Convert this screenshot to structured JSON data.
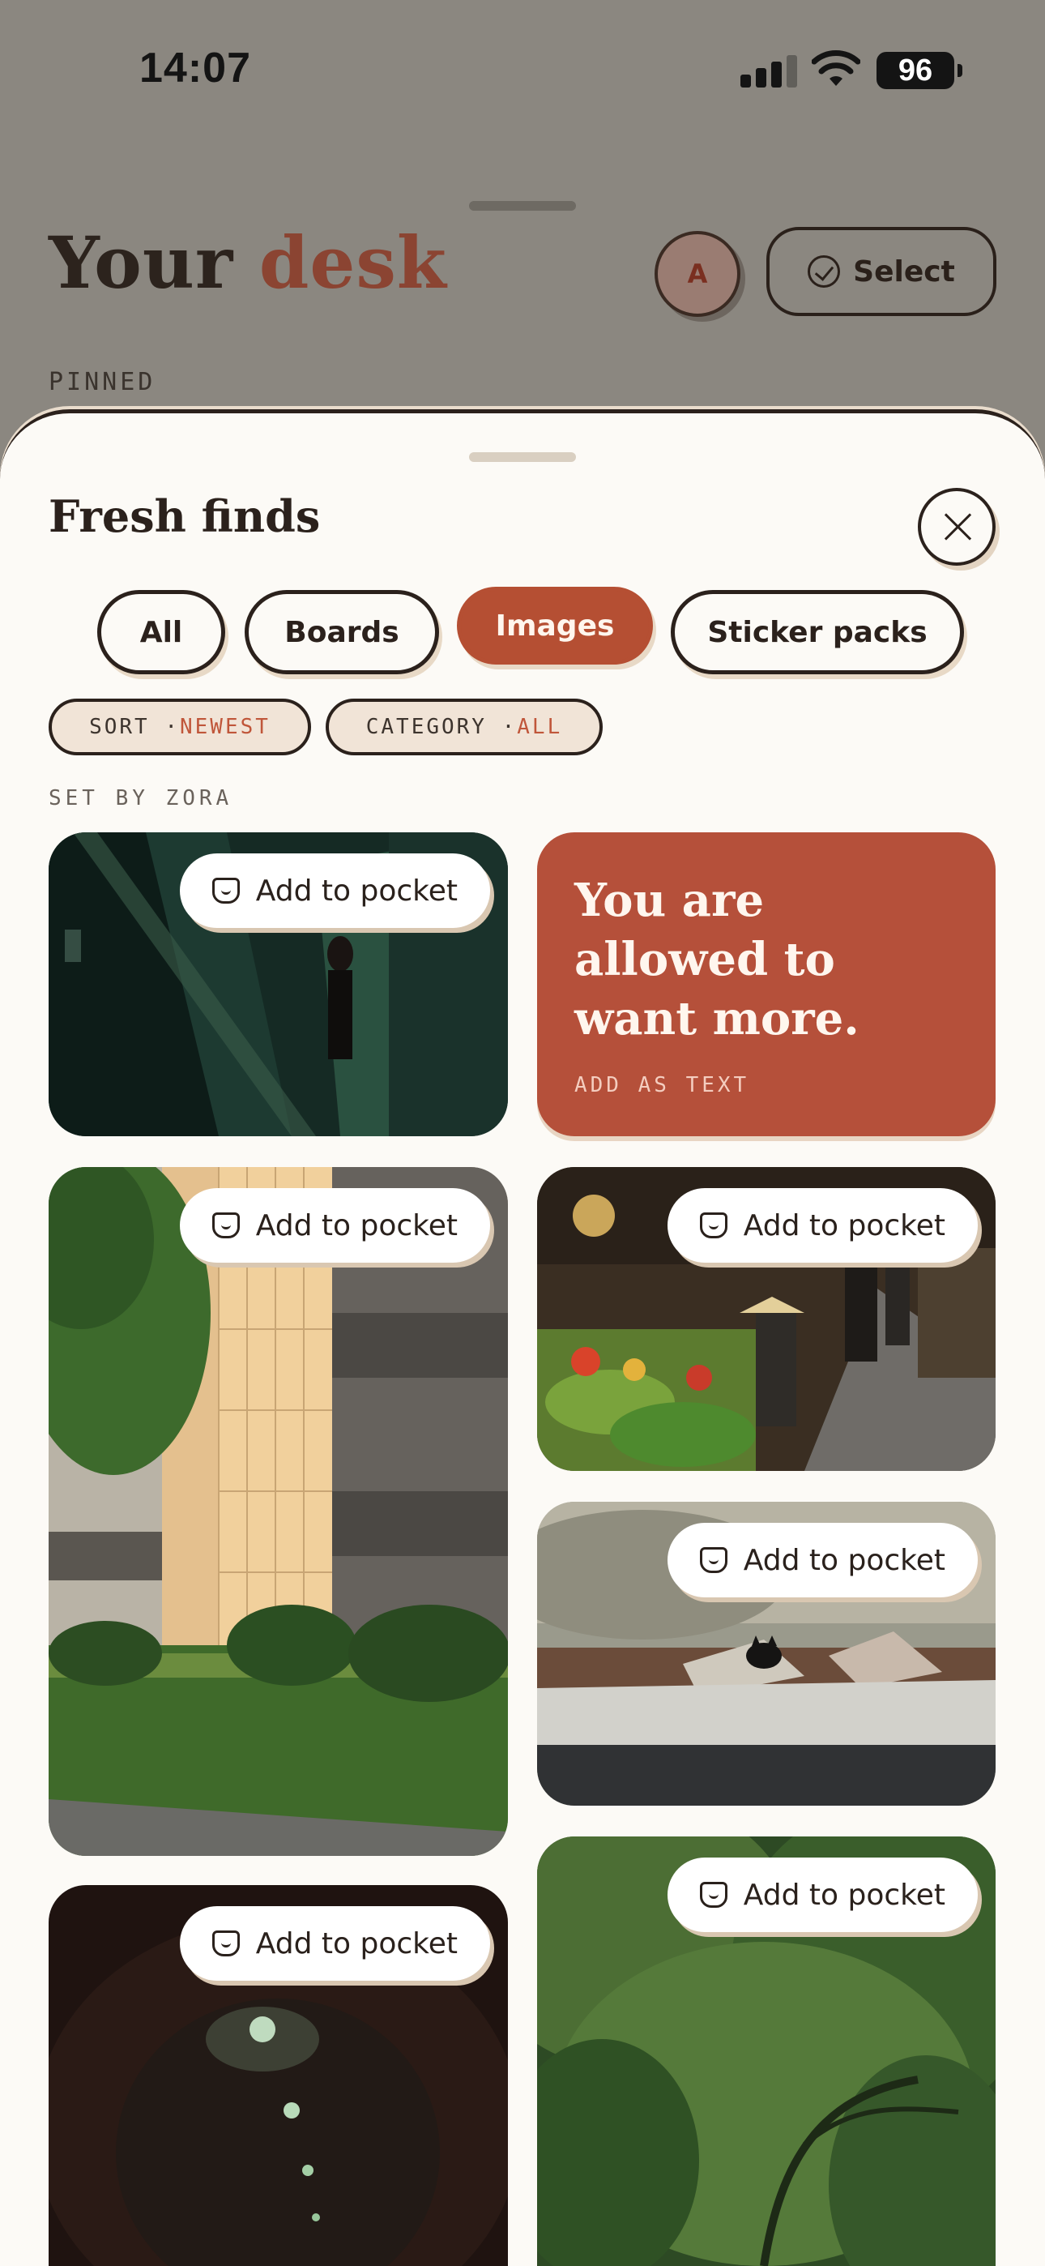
{
  "status_bar": {
    "time": "14:07",
    "battery": "96"
  },
  "background": {
    "title_part1": "Your",
    "title_part2": "desk",
    "avatar_initial": "A",
    "select_label": "Select",
    "pinned_label": "PINNED"
  },
  "sheet": {
    "title": "Fresh finds",
    "tabs": [
      {
        "label": "All",
        "active": false
      },
      {
        "label": "Boards",
        "active": false
      },
      {
        "label": "Images",
        "active": true
      },
      {
        "label": "Sticker packs",
        "active": false
      }
    ],
    "filters": [
      {
        "key": "SORT · ",
        "value": "NEWEST"
      },
      {
        "key": "CATEGORY · ",
        "value": "ALL"
      }
    ],
    "section_label": "SET BY ZORA",
    "quote": {
      "text": "You are allowed to want more.",
      "action": "ADD AS TEXT"
    },
    "cards": [
      {
        "subject": "person on stairway",
        "action": "Add to pocket"
      },
      {
        "subject": "apartment building",
        "action": "Add to pocket"
      },
      {
        "subject": "street market",
        "action": "Add to pocket"
      },
      {
        "subject": "cat on rooftop",
        "action": "Add to pocket"
      },
      {
        "subject": "tunnel lights",
        "action": "Add to pocket"
      },
      {
        "subject": "willow tree",
        "action": "Add to pocket"
      }
    ]
  },
  "colors": {
    "accent": "#b54f33",
    "ink": "#2b211c",
    "sheet": "#fcfaf6"
  }
}
